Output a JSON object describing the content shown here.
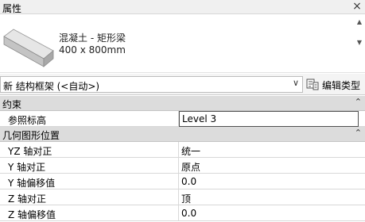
{
  "panel": {
    "title": "属性",
    "close_glyph": "×"
  },
  "type_selector": {
    "thumbnail_icon": "concrete-beam-icon",
    "family": "混凝土 - 矩形梁",
    "size": "400 x 800mm"
  },
  "instance_filter": {
    "value": "新 结构框架 (<自动>)"
  },
  "edit_type": {
    "label": "编辑类型"
  },
  "sections": {
    "constraints": {
      "title": "约束",
      "rows": [
        {
          "name": "参照标高",
          "value": "Level 3"
        }
      ]
    },
    "geometric_position": {
      "title": "几何图形位置",
      "rows": [
        {
          "name": "YZ 轴对正",
          "value": "统一"
        },
        {
          "name": "Y 轴对正",
          "value": "原点"
        },
        {
          "name": "Y 轴偏移值",
          "value": "0.0"
        },
        {
          "name": "Z 轴对正",
          "value": "顶"
        },
        {
          "name": "Z 轴偏移值",
          "value": "0.0"
        }
      ]
    }
  }
}
